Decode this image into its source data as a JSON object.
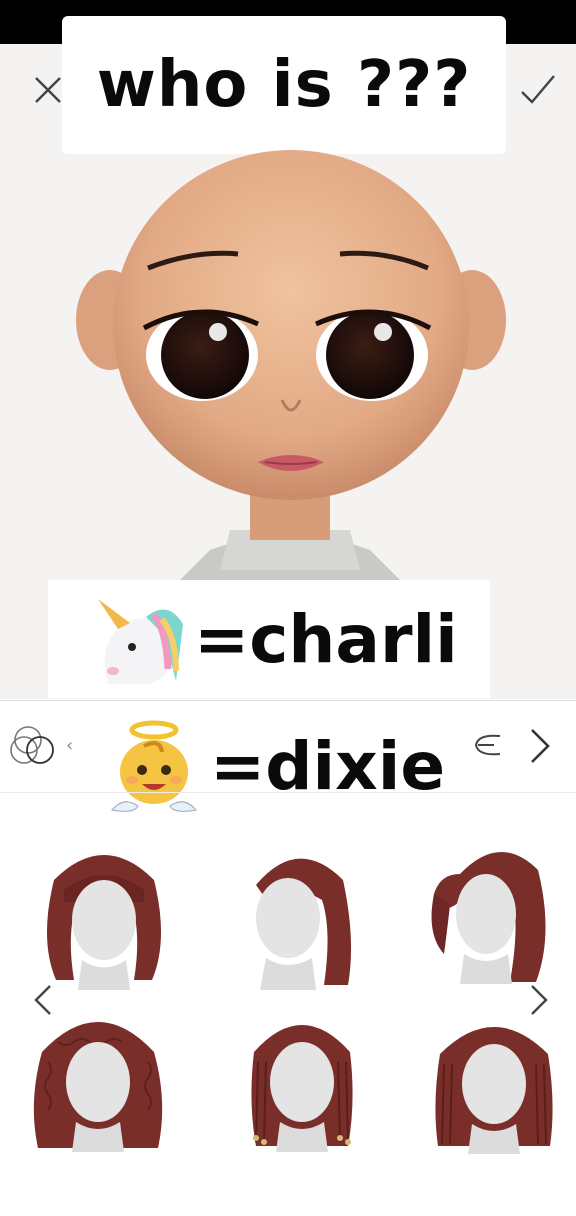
{
  "title": "who is ???",
  "captions": [
    {
      "emoji": "unicorn-emoji",
      "text": "=charli"
    },
    {
      "emoji": "baby-angel-emoji",
      "text": "=dixie"
    }
  ],
  "toolbar": {
    "close_icon": "close-icon",
    "confirm_icon": "check-icon"
  },
  "category_bar": {
    "left_icon": "layers-icon",
    "prev_glyph": "‹",
    "right_icon": "ear-icon",
    "next_icon": "chevron-right-icon"
  },
  "hair_options": [
    {
      "name": "long-wavy-with-bangs"
    },
    {
      "name": "side-swept-wavy"
    },
    {
      "name": "half-up-wavy"
    },
    {
      "name": "curly-long"
    },
    {
      "name": "beaded-braids"
    },
    {
      "name": "box-braids"
    }
  ],
  "colors": {
    "hair": "#7a2e2a",
    "skin": "#e7b48f",
    "canvas": "#f4f3f1"
  }
}
